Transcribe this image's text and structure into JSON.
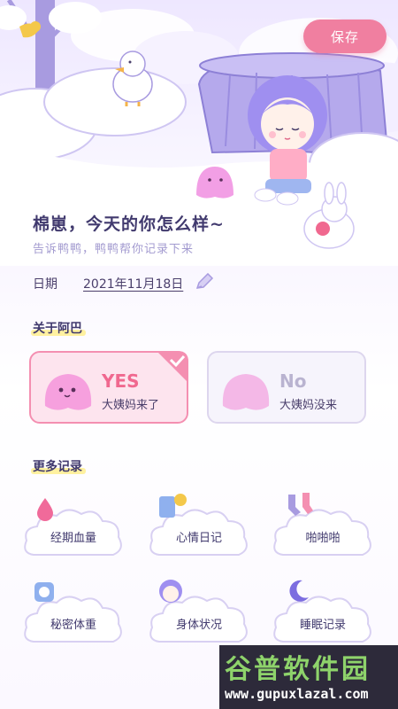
{
  "header": {
    "save_label": "保存"
  },
  "greeting": {
    "title": "棉崽，今天的你怎么样~",
    "subtitle": "告诉鸭鸭，鸭鸭帮你记录下来"
  },
  "date": {
    "label": "日期",
    "value": "2021年11月18日"
  },
  "about": {
    "title": "关于阿巴",
    "options": [
      {
        "big": "YES",
        "small": "大姨妈来了",
        "selected": true
      },
      {
        "big": "No",
        "small": "大姨妈没来",
        "selected": false
      }
    ]
  },
  "more": {
    "title": "更多记录",
    "items": [
      {
        "label": "经期血量",
        "icon": "blood-drop-icon"
      },
      {
        "label": "心情日记",
        "icon": "diary-icon"
      },
      {
        "label": "啪啪啪",
        "icon": "socks-icon"
      },
      {
        "label": "秘密体重",
        "icon": "scale-icon"
      },
      {
        "label": "身体状况",
        "icon": "girl-face-icon"
      },
      {
        "label": "睡眠记录",
        "icon": "moon-icon"
      }
    ]
  },
  "watermark": {
    "title": "谷普软件园",
    "url": "www.gupuxlazal.com"
  }
}
